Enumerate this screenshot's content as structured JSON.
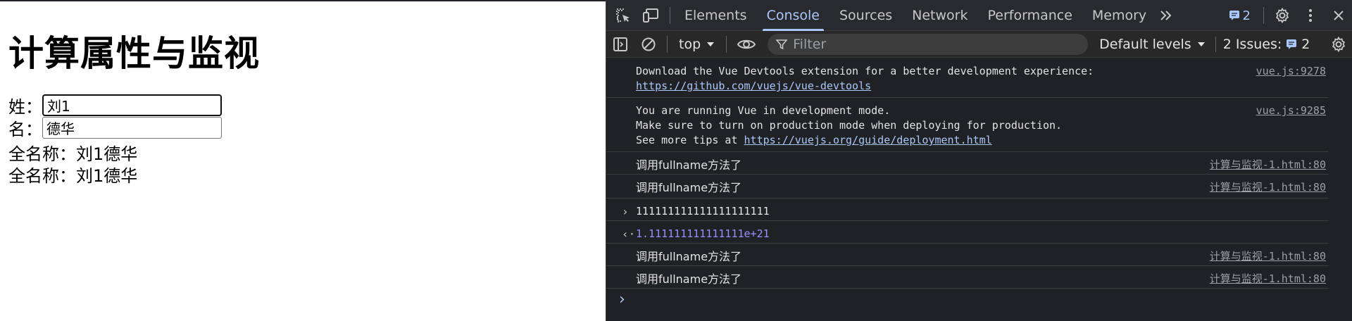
{
  "page": {
    "heading": "计算属性与监视",
    "surname_label": "姓：",
    "surname_value": "刘1",
    "given_label": "名：",
    "given_value": "德华",
    "full_name_1": "全名称：刘1德华",
    "full_name_2": "全名称：刘1德华"
  },
  "devtools": {
    "tabs": [
      "Elements",
      "Console",
      "Sources",
      "Network",
      "Performance",
      "Memory"
    ],
    "active_tab": "Console",
    "message_badge_count": "2",
    "context": "top",
    "filter_placeholder": "Filter",
    "default_levels": "Default levels",
    "issues_label": "2 Issues:",
    "issues_count": "2",
    "messages": [
      {
        "lines": [
          "Download the Vue Devtools extension for a better development experience:"
        ],
        "link": "https://github.com/vuejs/vue-devtools",
        "source": "vue.js:9278"
      },
      {
        "lines": [
          "You are running Vue in development mode.",
          "Make sure to turn on production mode when deploying for production."
        ],
        "link_prefix": "See more tips at ",
        "link": "https://vuejs.org/guide/deployment.html",
        "source": "vue.js:9285"
      },
      {
        "text": "调用fullname方法了",
        "source": "计算与监视-1.html:80"
      },
      {
        "text": "调用fullname方法了",
        "source": "计算与监视-1.html:80"
      },
      {
        "input": "111111111111111111111"
      },
      {
        "output": "1.111111111111111e+21"
      },
      {
        "text": "调用fullname方法了",
        "source": "计算与监视-1.html:80"
      },
      {
        "text": "调用fullname方法了",
        "source": "计算与监视-1.html:80"
      }
    ]
  },
  "colors": {
    "accent": "#a8c7fa",
    "result": "#9e8dff",
    "panel_bg": "#202124"
  }
}
